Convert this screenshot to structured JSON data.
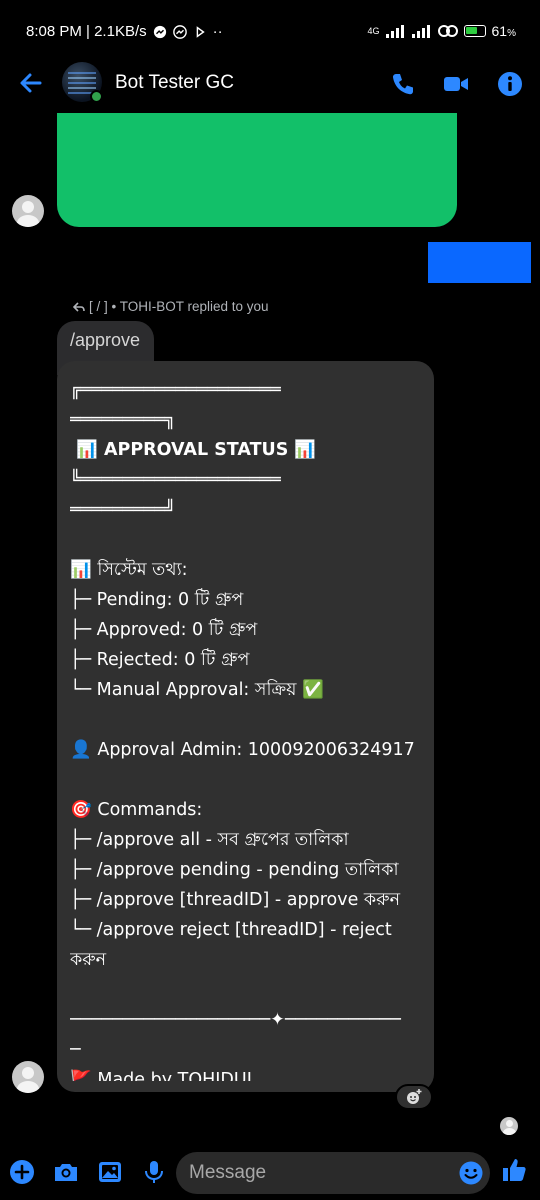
{
  "status_bar": {
    "time_speed": "8:08 PM | 2.1KB/s",
    "dots": "··",
    "network_label": "4G",
    "battery_text": "61"
  },
  "header": {
    "title": "Bot Tester GC"
  },
  "reply": {
    "info": "[ / ] • TOHI-BOT replied to you",
    "quoted_text": "/approve"
  },
  "bot_message": {
    "lines": [
      "╔═══════════════════",
      "═════════╗",
      " 📊 APPROVAL STATUS 📊",
      "╚═══════════════════",
      "═════════╝",
      "",
      "📊 সিস্টেম তথ্য:",
      "├─ Pending: 0 টি গ্রুপ",
      "├─ Approved: 0 টি গ্রুপ",
      "├─ Rejected: 0 টি গ্রুপ",
      "└─ Manual Approval: সক্রিয় ✅",
      "",
      "👤 Approval Admin: 100092006324917",
      "",
      "🎯 Commands:",
      "├─ /approve all - সব গ্রুপের তালিকা",
      "├─ /approve pending - pending তালিকা",
      "├─ /approve [threadID] - approve করুন",
      "└─ /approve reject [threadID] - reject",
      "করুন",
      "",
      "───────────────────✦───────────",
      "─",
      "🚩 Made by TOHIDUL",
      "───────────────────✦───────────",
      "─"
    ]
  },
  "composer": {
    "placeholder": "Message"
  },
  "colors": {
    "accent": "#0a7cff",
    "green_block": "#12c069",
    "blue_block": "#0a68ff",
    "bubble": "#303030"
  },
  "icons": {
    "header": [
      "back-arrow-icon",
      "phone-icon",
      "video-camera-icon",
      "info-icon"
    ],
    "composer": [
      "plus-icon",
      "camera-icon",
      "image-icon",
      "microphone-icon",
      "emoji-icon",
      "thumbs-up-icon"
    ]
  }
}
